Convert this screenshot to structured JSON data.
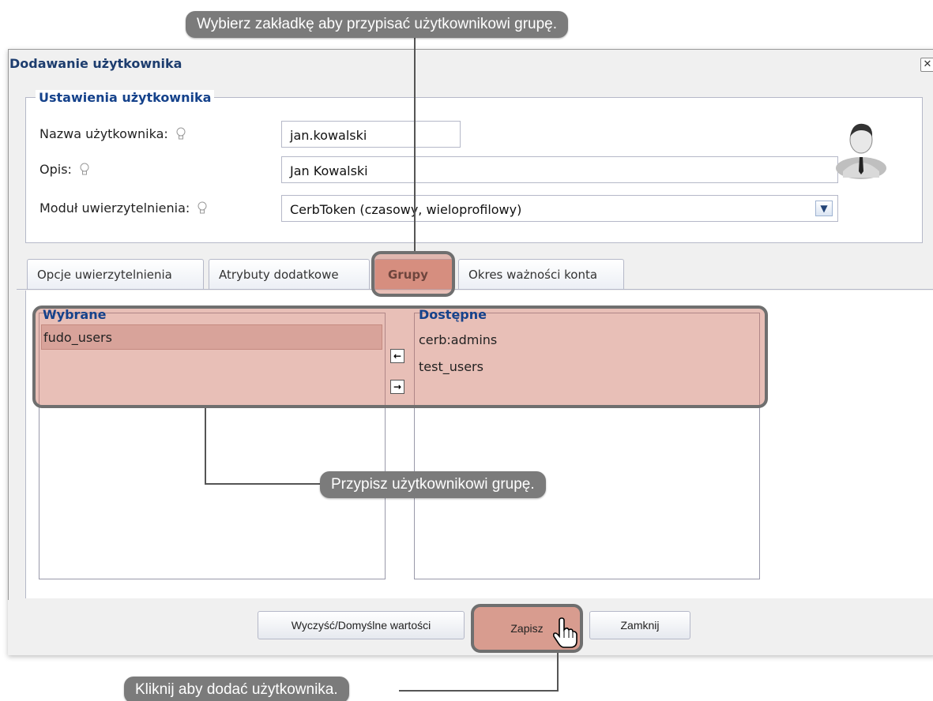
{
  "callouts": {
    "top": "Wybierz zakładkę aby przypisać użytkownikowi grupę.",
    "middle": "Przypisz użytkownikowi grupę.",
    "bottom": "Kliknij aby dodać użytkownika."
  },
  "dialog": {
    "title": "Dodawanie użytkownika",
    "close_symbol": "✕"
  },
  "settings": {
    "legend": "Ustawienia użytkownika",
    "username_label": "Nazwa użytkownika:",
    "username_value": "jan.kowalski",
    "description_label": "Opis:",
    "description_value": "Jan Kowalski",
    "auth_module_label": "Moduł uwierzytelnienia:",
    "auth_module_value": "CerbToken (czasowy, wieloprofilowy)"
  },
  "tabs": [
    {
      "label": "Opcje uwierzytelnienia"
    },
    {
      "label": "Atrybuty dodatkowe"
    },
    {
      "label": "Grupy"
    },
    {
      "label": "Okres ważności konta"
    }
  ],
  "groups": {
    "selected_legend": "Wybrane",
    "selected_items": [
      "fudo_users"
    ],
    "available_legend": "Dostępne",
    "available_items": [
      "cerb:admins",
      "test_users"
    ],
    "move_left_symbol": "←",
    "move_right_symbol": "→"
  },
  "footer": {
    "reset_label": "Wyczyść/Domyślne wartości",
    "save_label": "Zapisz",
    "close_label": "Zamknij"
  },
  "colors": {
    "highlight": "#d89c8f",
    "callout": "#7b7b7b",
    "accent": "#15428b"
  }
}
